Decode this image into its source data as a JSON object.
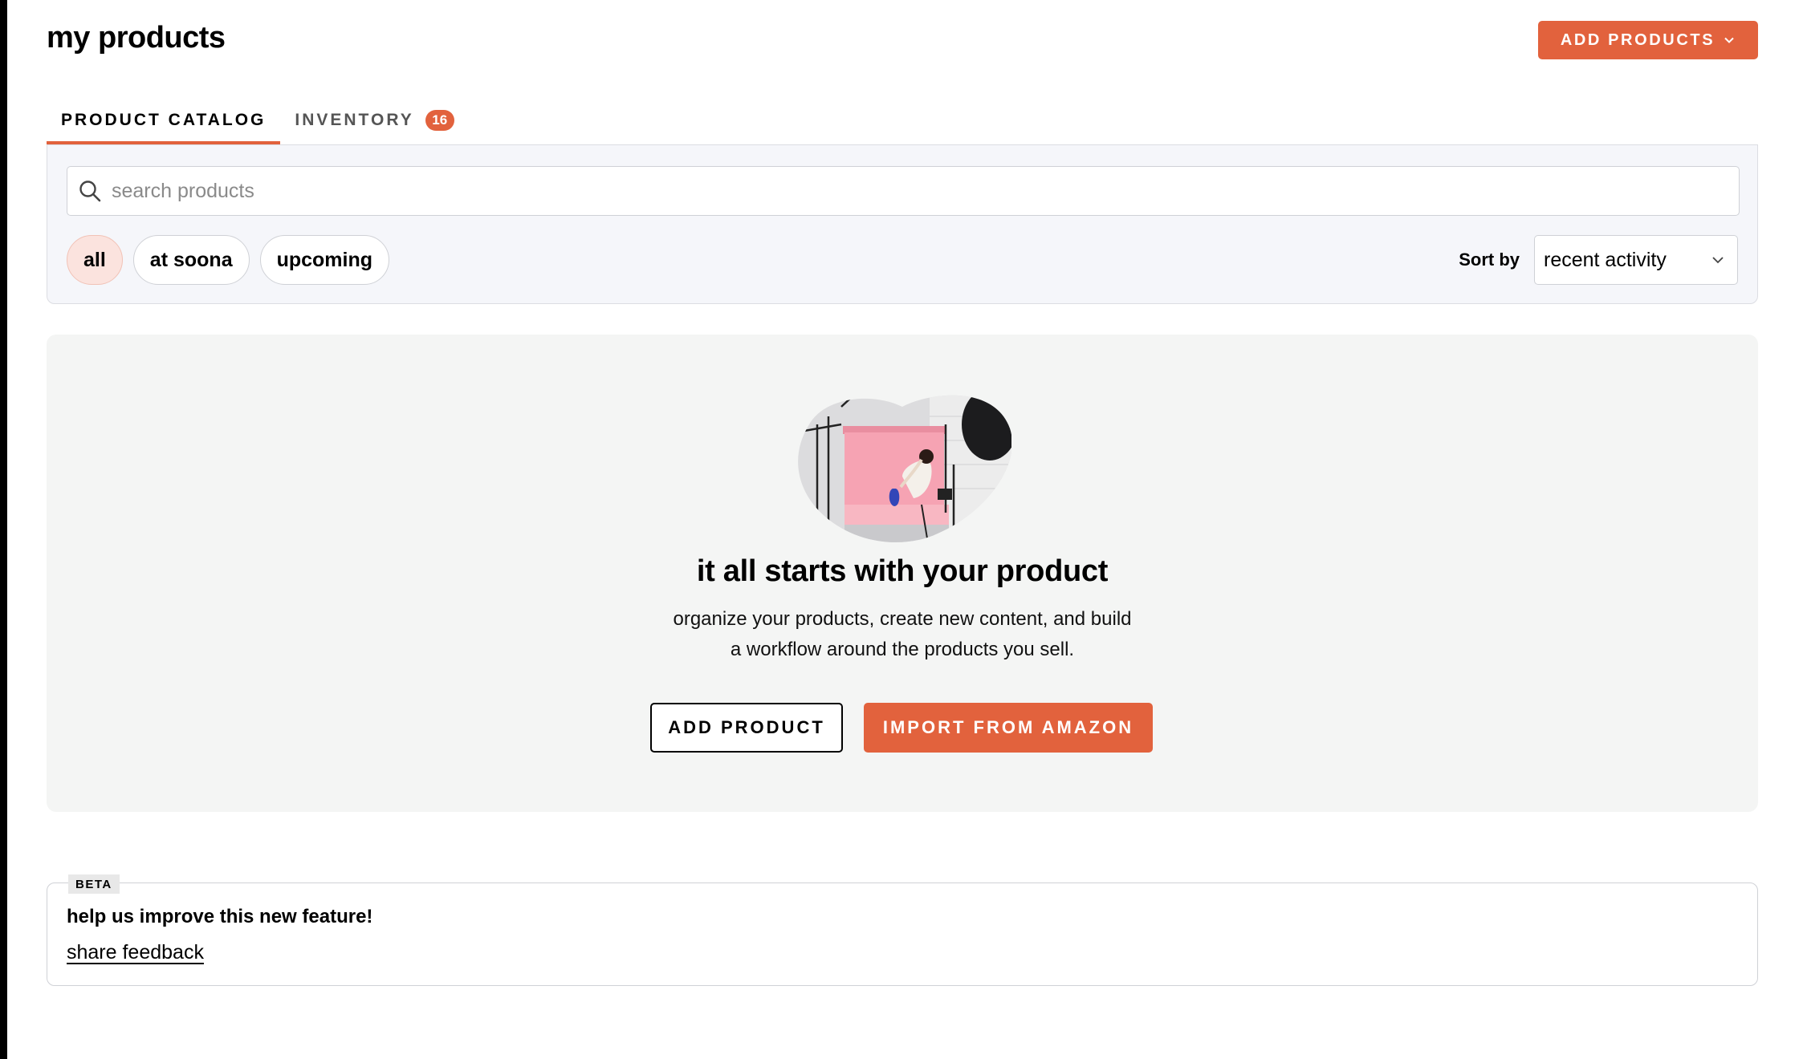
{
  "header": {
    "title": "my products",
    "add_products_label": "ADD PRODUCTS"
  },
  "tabs": [
    {
      "label": "PRODUCT CATALOG",
      "active": true
    },
    {
      "label": "INVENTORY",
      "badge": "16",
      "active": false
    }
  ],
  "search": {
    "placeholder": "search products",
    "value": ""
  },
  "filters": {
    "chips": [
      {
        "label": "all",
        "selected": true
      },
      {
        "label": "at soona",
        "selected": false
      },
      {
        "label": "upcoming",
        "selected": false
      }
    ],
    "sort_label": "Sort by",
    "sort_value": "recent activity"
  },
  "empty_state": {
    "title": "it all starts with your product",
    "description_line1": "organize your products, create new content, and build",
    "description_line2": "a workflow around the products you sell.",
    "add_product_label": "ADD PRODUCT",
    "import_label": "IMPORT FROM AMAZON"
  },
  "feedback": {
    "badge": "BETA",
    "title": "help us improve this new feature!",
    "link": "share feedback"
  },
  "colors": {
    "accent": "#e2623d",
    "selected_chip_bg": "#fbe3de",
    "panel_bg": "#f5f6fa",
    "empty_bg": "#f4f5f4"
  },
  "icons": [
    "search-icon",
    "chevron-down-icon",
    "studio-illustration"
  ]
}
